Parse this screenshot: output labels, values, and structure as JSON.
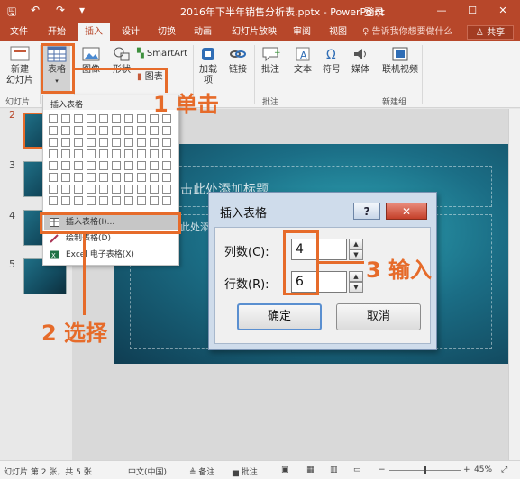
{
  "window": {
    "title": "2016年下半年销售分析表.pptx - PowerPoint",
    "login": "登录",
    "minimize_glyph": "—",
    "maximize_glyph": "☐",
    "close_glyph": "✕"
  },
  "qat": {
    "save_glyph": "🖫",
    "undo_glyph": "↶",
    "redo_glyph": "↷",
    "customize_glyph": "▾"
  },
  "tabs": [
    {
      "label": "文件"
    },
    {
      "label": "开始"
    },
    {
      "label": "插入"
    },
    {
      "label": "设计"
    },
    {
      "label": "切换"
    },
    {
      "label": "动画"
    },
    {
      "label": "幻灯片放映"
    },
    {
      "label": "审阅"
    },
    {
      "label": "视图"
    }
  ],
  "tell_me": "♀ 告诉我你想要做什么",
  "share": "♙ 共享",
  "ribbon": {
    "new_slide_line1": "新建",
    "new_slide_line2": "幻灯片",
    "table": "表格",
    "image": "图像",
    "shapes": "形状",
    "smartart": "SmartArt",
    "chart": "图表",
    "addins_line1": "加载",
    "addins_line2": "项",
    "link": "链接",
    "comment": "批注",
    "text": "文本",
    "symbol": "符号",
    "media": "媒体",
    "online_video": "联机视频",
    "groups": {
      "slides": "幻灯片",
      "comments": "批注",
      "new_group": "新建组"
    }
  },
  "thumbnails": {
    "numbers": [
      "2",
      "3",
      "4",
      "5"
    ]
  },
  "slide": {
    "title_placeholder": "击此处添加标题",
    "text_placeholder": "此处添"
  },
  "dropdown": {
    "header": "插入表格",
    "grid_cols": 10,
    "grid_rows": 8,
    "items": [
      {
        "label": "插入表格(I)...",
        "highlighted": true
      },
      {
        "label": "绘制表格(D)",
        "highlighted": false
      },
      {
        "label": "Excel 电子表格(X)",
        "highlighted": false
      }
    ]
  },
  "dialog": {
    "title": "插入表格",
    "help_glyph": "?",
    "close_glyph": "✕",
    "columns_label": "列数(C):",
    "columns_value": "4",
    "rows_label": "行数(R):",
    "rows_value": "6",
    "ok": "确定",
    "cancel": "取消"
  },
  "annotations": {
    "step1": "1 单击",
    "step2": "2 选择",
    "step3": "3 输入",
    "color": "#e66b2a"
  },
  "statusbar": {
    "slide_info": "幻灯片 第 2 张，共 5 张",
    "language": "中文(中国)",
    "notes": "≜ 备注",
    "comments": "▅ 批注",
    "zoom": "45%"
  },
  "colors": {
    "accent": "#b7472a",
    "ribbon_bg": "#f3f3f3"
  }
}
